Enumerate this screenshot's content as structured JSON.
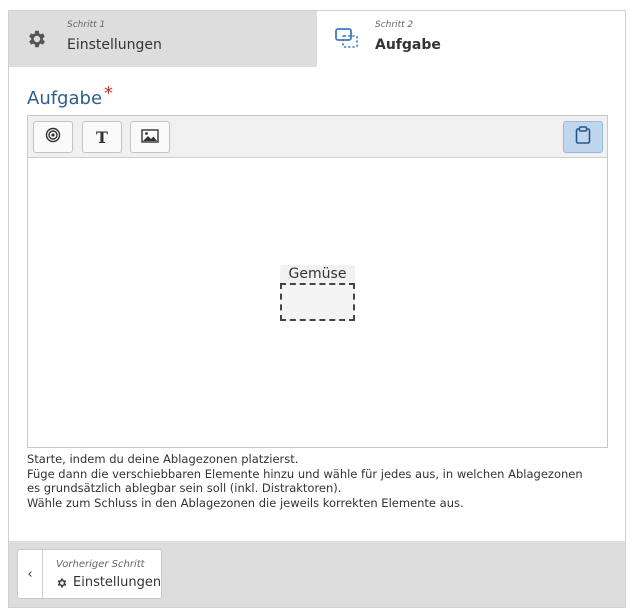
{
  "steps": [
    {
      "small": "Schritt 1",
      "label": "Einstellungen",
      "icon": "gear-icon",
      "active": false
    },
    {
      "small": "Schritt 2",
      "label": "Aufgabe",
      "icon": "dropzone-icon",
      "active": true
    }
  ],
  "section": {
    "title": "Aufgabe",
    "required_marker": "*"
  },
  "toolbar": {
    "buttons": [
      {
        "name": "add-dropzone-button",
        "icon": "target-icon"
      },
      {
        "name": "add-text-button",
        "icon": "text-icon",
        "glyph": "T"
      },
      {
        "name": "add-image-button",
        "icon": "image-icon"
      },
      {
        "name": "paste-button",
        "icon": "clipboard-icon",
        "active": true
      }
    ]
  },
  "canvas": {
    "dropzone_label": "Gemüse"
  },
  "instructions": [
    "Starte, indem du deine Ablagezonen platzierst.",
    "Füge dann die verschiebbaren Elemente hinzu und wähle für jedes aus, in welchen Ablagezonen",
    "es grundsätzlich ablegbar sein soll (inkl. Distraktoren).",
    "Wähle zum Schluss in den Ablagezonen die jeweils korrekten Elemente aus."
  ],
  "footer": {
    "prev_small": "Vorheriger Schritt",
    "prev_label": "Einstellungen",
    "prev_chevron": "‹"
  },
  "colors": {
    "heading": "#2c5f8e",
    "required": "#c9302c",
    "active_toolbar_button": "#bfd7ee",
    "tab_inactive_bg": "#dddddd"
  }
}
